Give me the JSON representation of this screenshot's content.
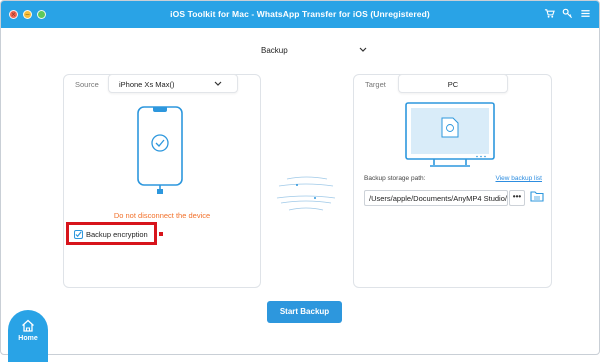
{
  "window": {
    "title": "iOS Toolkit for Mac - WhatsApp Transfer for iOS (Unregistered)",
    "close_glyph": "×",
    "minimize_glyph": "−",
    "top_icons": [
      "cart-icon",
      "key-icon",
      "menu-icon"
    ]
  },
  "mode": {
    "label": "Backup"
  },
  "source": {
    "label": "Source",
    "device": "iPhone Xs Max()",
    "warning": "Do not disconnect the device",
    "encryption_label": "Backup encryption",
    "encryption_checked": true
  },
  "target": {
    "label": "Target",
    "value": "PC",
    "storage_path_label": "Backup storage path:",
    "view_list_link": "View backup list",
    "path_value": "/Users/apple/Documents/AnyMP4 Studio/",
    "browse_label": "•••"
  },
  "actions": {
    "start_label": "Start Backup"
  },
  "nav": {
    "home_label": "Home"
  },
  "colors": {
    "accent": "#29a3e6",
    "button": "#2d97dd",
    "warning": "#f2712b",
    "highlight": "#d7141b"
  }
}
